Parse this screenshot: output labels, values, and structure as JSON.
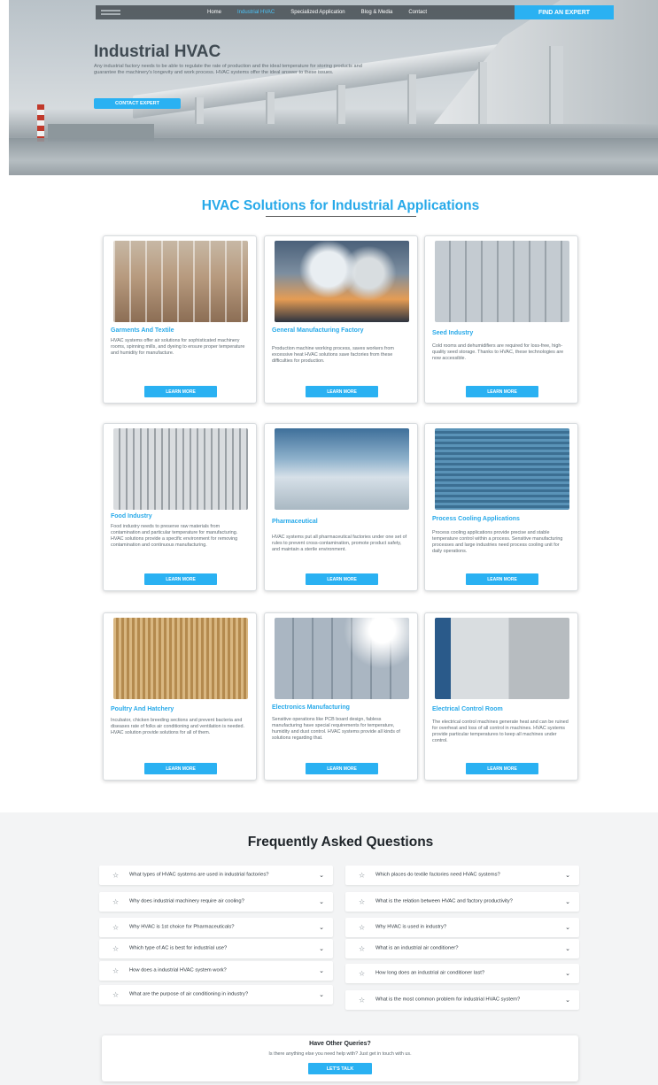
{
  "nav": {
    "items": [
      "Home",
      "Industrial HVAC",
      "Specialized Application",
      "Blog & Media",
      "Contact"
    ],
    "active_index": 1,
    "cta_label": "FIND AN EXPERT"
  },
  "hero": {
    "title": "Industrial HVAC",
    "description": "Any industrial factory needs to be able to regulate the rate of production and the ideal temperature for storing products and guarantee the machinery's longevity and work process. HVAC systems offer the ideal answer to these issues.",
    "button_label": "CONTACT EXPERT"
  },
  "solutions": {
    "title": "HVAC Solutions for Industrial Applications",
    "cards": [
      {
        "title": "Garments And Textile",
        "desc": "HVAC systems offer air solutions for sophisticated machinery rooms, spinning mills, and dyeing to ensure proper temperature and humidity for manufacture.",
        "button": "LEARN MORE"
      },
      {
        "title": "General Manufacturing Factory",
        "desc": "Production machine working process, saves workers from excessive heat HVAC solutions save factories from these difficulties for production.",
        "button": "LEARN MORE"
      },
      {
        "title": "Seed Industry",
        "desc": "Cold rooms and dehumidifiers are required for loss-free, high-quality seed storage. Thanks to HVAC, these technologies are now accessible.",
        "button": "LEARN MORE"
      },
      {
        "title": "Food Industry",
        "desc": "Food industry needs to preserve raw materials from contamination and particular temperature for manufacturing. HVAC solutions provide a specific environment for removing contamination and continuous manufacturing.",
        "button": "LEARN MORE"
      },
      {
        "title": "Pharmaceutical",
        "desc": "HVAC systems put all pharmaceutical factories under one set of rules to prevent cross-contamination, promote product safety, and maintain a sterile environment.",
        "button": "LEARN MORE"
      },
      {
        "title": "Process Cooling Applications",
        "desc": "Process cooling applications provide precise and stable temperature control within a process. Sensitive manufacturing processes and large industries need process cooling unit for daily operations.",
        "button": "LEARN MORE"
      },
      {
        "title": "Poultry And Hatchery",
        "desc": "Incubator, chicken breeding sections and prevent bacteria and diseases rate of folks air conditioning and ventilation is needed. HVAC solution provide solutions for all of them.",
        "button": "LEARN MORE"
      },
      {
        "title": "Electronics Manufacturing",
        "desc": "Sensitive operations like PCB board design, fabless manufacturing have special requirements for temperature, humidity and dust control. HVAC systems provide all kinds of solutions regarding that.",
        "button": "LEARN MORE"
      },
      {
        "title": "Electrical Control Room",
        "desc": "The electrical control machines generate heat and can be ruined for overheat and loss of all control in machines. HVAC systems provide particular temperatures to keep all machines under control.",
        "button": "LEARN MORE"
      }
    ]
  },
  "faq": {
    "title": "Frequently Asked Questions",
    "left": [
      "What types of HVAC systems are used in industrial factories?",
      "Why does industrial machinery require air cooling?",
      "Why HVAC is 1st choice for Pharmaceuticals?",
      "Which type of AC is best for industrial use?",
      "How does a industrial HVAC system work?",
      "What are the purpose of air conditioning in industry?"
    ],
    "right": [
      "Which places do textile factories need HVAC systems?",
      "What is the relation between HVAC and factory productivity?",
      "Why HVAC is used in industry?",
      "What is an industrial air conditioner?",
      "How long does an industrial air conditioner last?",
      "What is the most common problem for industrial HVAC system?"
    ]
  },
  "queries": {
    "title": "Have Other Queries?",
    "desc": "Is there anything else you need help with? Just get in touch with us.",
    "button": "LET'S TALK"
  },
  "colors": {
    "accent": "#2ab1f2",
    "title_blue": "#27a9e9",
    "faq_bg": "#f3f4f5"
  }
}
